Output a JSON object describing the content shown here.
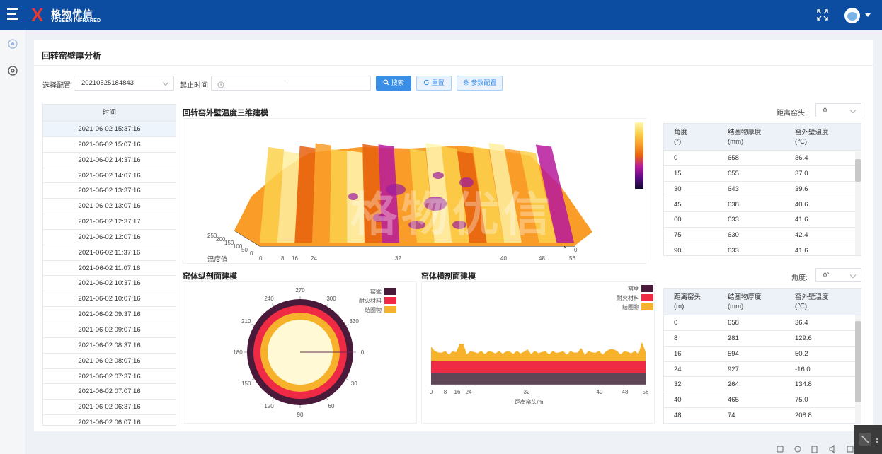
{
  "header": {
    "logo_mark": "X",
    "brand_cn": "格物优信",
    "brand_en": "YOSEEN INFRARED"
  },
  "page": {
    "title": "回转窑壁厚分析"
  },
  "filters": {
    "config_label": "选择配置",
    "config_value": "20210525184843",
    "time_label": "起止时间",
    "time_separator": "-",
    "search_label": "搜索",
    "reset_label": "重置",
    "params_label": "参数配置"
  },
  "time_list": {
    "header": "时间",
    "rows": [
      "2021-06-02 15:37:16",
      "2021-06-02 15:07:16",
      "2021-06-02 14:37:16",
      "2021-06-02 14:07:16",
      "2021-06-02 13:37:16",
      "2021-06-02 13:07:16",
      "2021-06-02 12:37:17",
      "2021-06-02 12:07:16",
      "2021-06-02 11:37:16",
      "2021-06-02 11:07:16",
      "2021-06-02 10:37:16",
      "2021-06-02 10:07:16",
      "2021-06-02 09:37:16",
      "2021-06-02 09:07:16",
      "2021-06-02 08:37:16",
      "2021-06-02 08:07:16",
      "2021-06-02 07:37:16",
      "2021-06-02 07:07:16",
      "2021-06-02 06:37:16",
      "2021-06-02 06:07:16"
    ],
    "selected_index": 0
  },
  "model3d": {
    "title": "回转窑外壁温度三维建模",
    "axis_temp_label": "温度值",
    "axis_temp_ticks": [
      "250",
      "200",
      "150",
      "100",
      "50",
      "0"
    ],
    "axis_len_ticks": [
      "0",
      "8",
      "16",
      "24",
      "32",
      "40",
      "48",
      "56"
    ],
    "axis_depth_tick": "0",
    "watermark": "格物优信",
    "colorbar": [
      "#fff7b0",
      "#fbd14b",
      "#f99d28",
      "#e8620e",
      "#b7199b",
      "#5b0b86",
      "#110a2e"
    ]
  },
  "distance_select": {
    "label": "距离窑头:",
    "value": "0"
  },
  "table_angle": {
    "headers": [
      [
        "角度",
        "(°)"
      ],
      [
        "结圈物厚度",
        "(mm)"
      ],
      [
        "窑外壁温度",
        "(℃)"
      ]
    ],
    "rows": [
      [
        "0",
        "658",
        "36.4"
      ],
      [
        "15",
        "655",
        "37.0"
      ],
      [
        "30",
        "643",
        "39.6"
      ],
      [
        "45",
        "638",
        "40.6"
      ],
      [
        "60",
        "633",
        "41.6"
      ],
      [
        "75",
        "630",
        "42.4"
      ],
      [
        "90",
        "633",
        "41.6"
      ]
    ]
  },
  "angle_select": {
    "label": "角度:",
    "value": "0°"
  },
  "table_distance": {
    "headers": [
      [
        "距离窑头",
        "(m)"
      ],
      [
        "结圈物厚度",
        "(mm)"
      ],
      [
        "窑外壁温度",
        "(℃)"
      ]
    ],
    "rows": [
      [
        "0",
        "658",
        "36.4"
      ],
      [
        "8",
        "281",
        "129.6"
      ],
      [
        "16",
        "594",
        "50.2"
      ],
      [
        "24",
        "927",
        "-16.0"
      ],
      [
        "32",
        "264",
        "134.8"
      ],
      [
        "40",
        "465",
        "75.0"
      ],
      [
        "48",
        "74",
        "208.8"
      ]
    ]
  },
  "polar": {
    "title": "窑体纵剖面建模",
    "angle_labels": [
      "270",
      "300",
      "330",
      "0",
      "30",
      "60",
      "90",
      "120",
      "150",
      "180",
      "210",
      "240"
    ],
    "legend": [
      {
        "name": "窑壁",
        "color": "#4a1a3a"
      },
      {
        "name": "耐火材料",
        "color": "#ef2a44"
      },
      {
        "name": "结圈物",
        "color": "#f7b22b"
      }
    ],
    "inner_color": "#fff9d6"
  },
  "profile": {
    "title": "窑体横剖面建模",
    "xlabel": "距离窑头/m",
    "x_ticks": [
      "0",
      "8",
      "16",
      "24",
      "32",
      "40",
      "48",
      "56"
    ],
    "legend": [
      {
        "name": "窑壁",
        "color": "#4a1a3a"
      },
      {
        "name": "耐火材料",
        "color": "#ef2a44"
      },
      {
        "name": "结圈物",
        "color": "#f7b22b"
      }
    ],
    "wall_color": "#5e4656",
    "refractory_color": "#ef2a44",
    "deposit_color": "#f7b22b"
  }
}
